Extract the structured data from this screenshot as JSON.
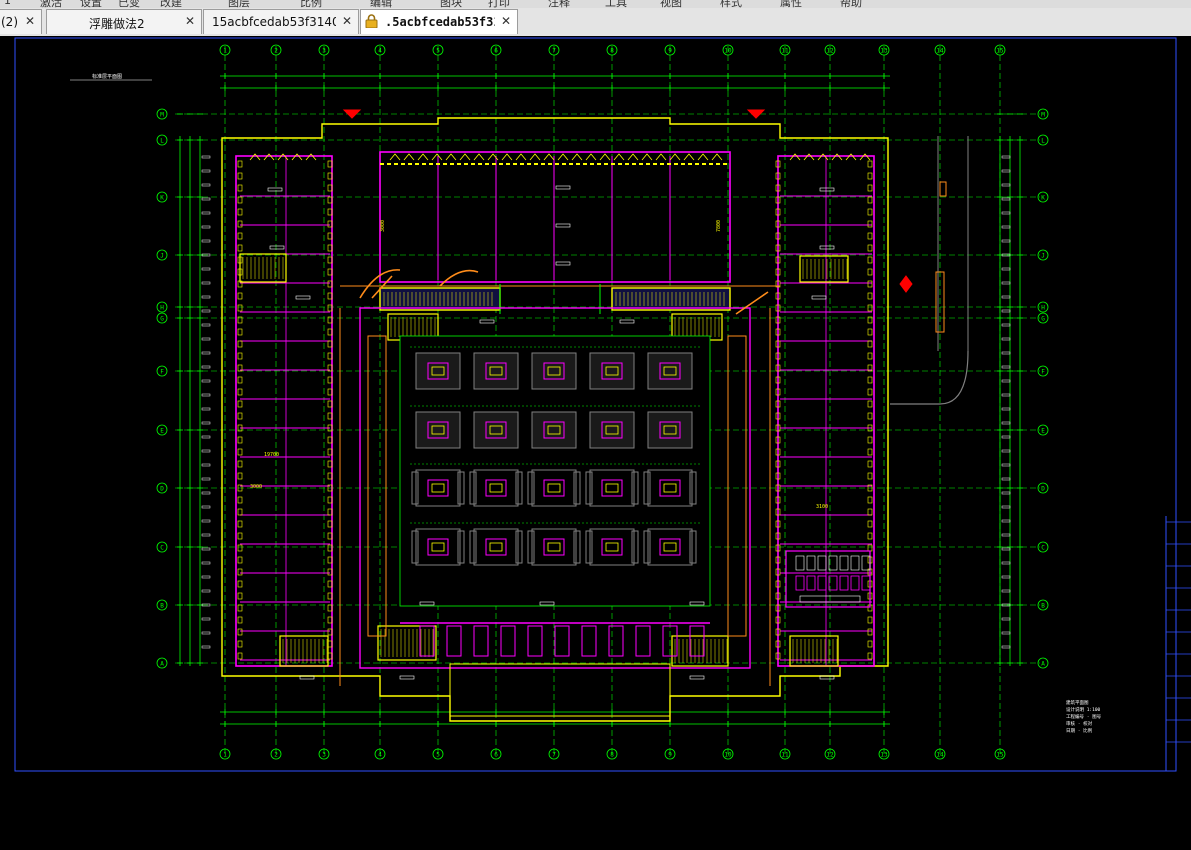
{
  "menu_fragments": [
    "1",
    "激活",
    "设置",
    "已变",
    "改建",
    "图层",
    "比例",
    "编辑",
    "图块",
    "打印",
    "注释",
    "工具",
    "视图",
    "样式",
    "属性",
    "帮助"
  ],
  "tabs": [
    {
      "label": "(2)",
      "active": false,
      "locked": false
    },
    {
      "label": "浮雕做法2",
      "active": false,
      "locked": false
    },
    {
      "label": "15acbfcedab53f31402…",
      "active": false,
      "locked": false
    },
    {
      "label": ".5acbfcedab53f31·",
      "active": true,
      "locked": true
    }
  ],
  "close_glyph": "✕",
  "drawing": {
    "background": "#000000",
    "colors": {
      "axis": "#00ff00",
      "wall": "#ff00ff",
      "column": "#ffff00",
      "dimension": "#00ff00",
      "marker_red": "#ff0000",
      "frame": "#3050ff",
      "stair": "#ffff00",
      "annotation": "#ffffff",
      "orange": "#ff8c1a",
      "cyan": "#00ffff",
      "grey": "#808080"
    },
    "column_axes": [
      "1",
      "2",
      "3",
      "4",
      "5",
      "6",
      "7",
      "8",
      "9",
      "10",
      "11",
      "12",
      "13",
      "14",
      "15"
    ],
    "row_axes": [
      "M",
      "L",
      "K",
      "J",
      "H",
      "G",
      "F",
      "E",
      "D",
      "C",
      "B",
      "A"
    ],
    "top_left_note": "标准层平面图",
    "dimension_labels": [
      "3000",
      "7800",
      "3000",
      "19700",
      "3100"
    ],
    "title_block_lines": [
      "建筑平面图",
      "设计说明 1:100",
      "工程编号 · 图号",
      "审核 · 校对",
      "日期 · 比例"
    ]
  }
}
